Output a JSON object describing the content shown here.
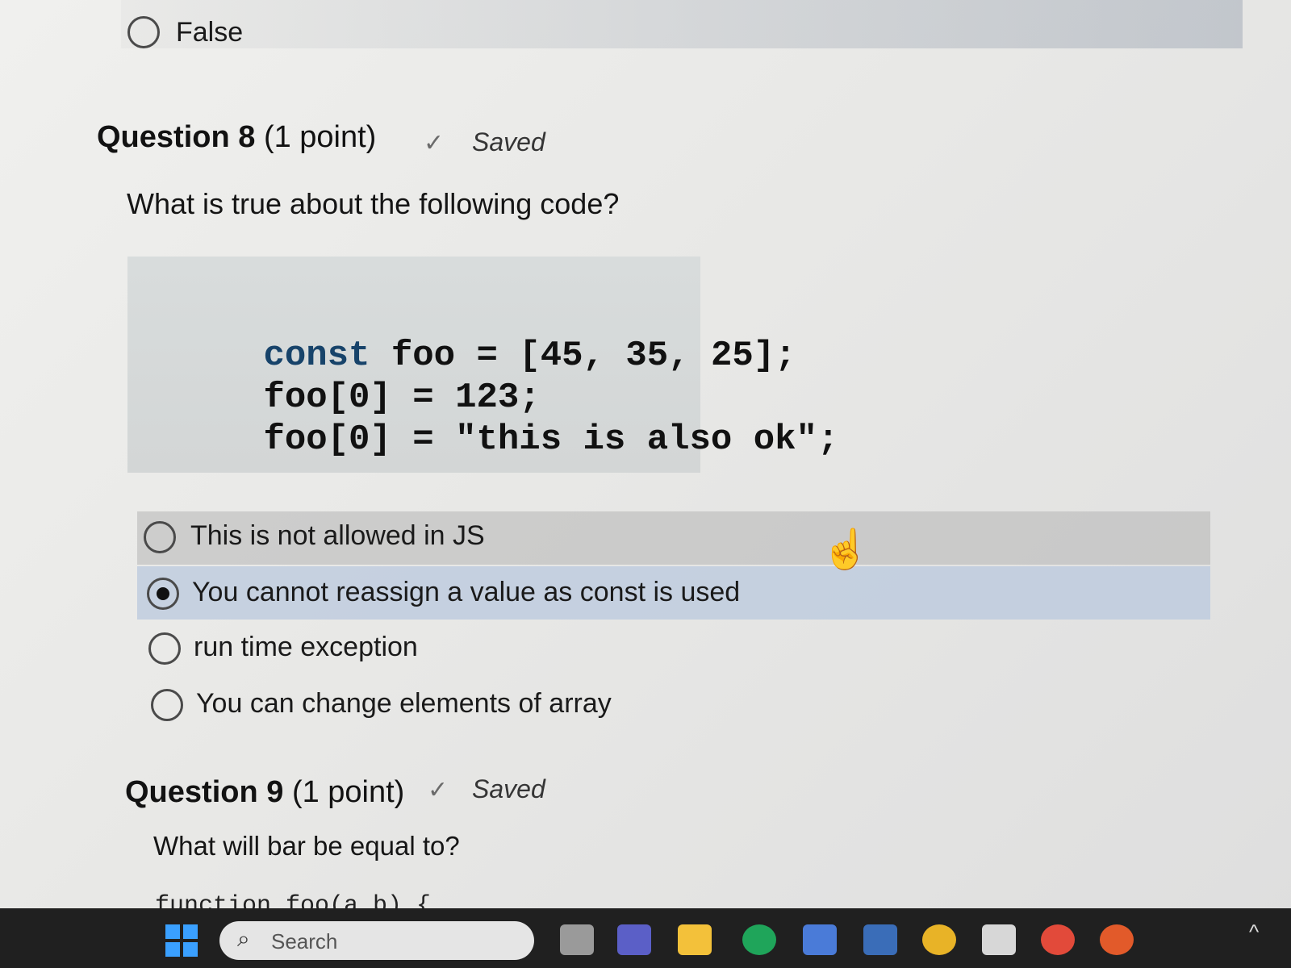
{
  "previous_question": {
    "option_label": "False"
  },
  "question8": {
    "title_prefix": "Question 8",
    "points": "(1 point)",
    "status": "Saved",
    "prompt": "What is true about the following code?",
    "code_lines": [
      {
        "kw": "const",
        "rest": " foo = [45, 35, 25];"
      },
      {
        "kw": "",
        "rest": "foo[0] = 123;"
      },
      {
        "kw": "",
        "rest": "foo[0] = \"this is also ok\";"
      }
    ],
    "options": [
      {
        "label": "This is not allowed in JS",
        "selected": false
      },
      {
        "label": "You cannot reassign a value as const is used",
        "selected": true
      },
      {
        "label": "run time exception",
        "selected": false
      },
      {
        "label": "You can change elements of array",
        "selected": false
      }
    ]
  },
  "question9": {
    "title_prefix": "Question 9",
    "points": "(1 point)",
    "status": "Saved",
    "prompt": "What will bar be equal to?",
    "code_preview": "function foo(a,b) {"
  },
  "taskbar": {
    "search_placeholder": "Search",
    "icons": [
      "start-icon",
      "task-view-icon",
      "teams-icon",
      "file-explorer-icon",
      "edge-icon",
      "store-icon",
      "mcafee-icon",
      "chrome-icon",
      "snipping-tool-icon",
      "chrome-profile-icon",
      "chrome-canary-icon"
    ],
    "colors": {
      "taskbar_bg": "#202020",
      "accent_blue": "#3aa0ff"
    }
  }
}
